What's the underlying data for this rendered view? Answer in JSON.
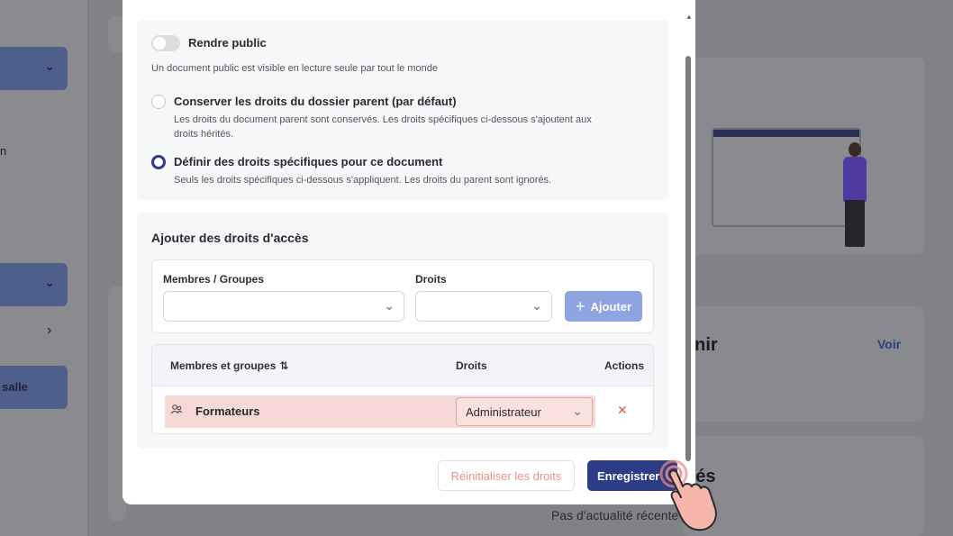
{
  "background": {
    "sidebar_item_1": "salle",
    "card_title_1": "enir",
    "card_link": "Voir",
    "card_title_2": "ités",
    "card_subtitle": "Pas d'actualité récente"
  },
  "modal": {
    "public_toggle": {
      "label": "Rendre public",
      "description": "Un document public est visible en lecture seule par tout le monde",
      "on": false
    },
    "options": [
      {
        "label": "Conserver les droits du dossier parent (par défaut)",
        "description_line1": "Les droits du document parent sont conservés. Les droits spécifiques ci-dessous s'ajoutent aux",
        "description_line2": "droits hérités.",
        "selected": false
      },
      {
        "label": "Définir des droits spécifiques pour ce document",
        "description_line1": "Seuls les droits spécifiques ci-dessous s'appliquent. Les droits du parent sont ignorés.",
        "description_line2": "",
        "selected": true
      }
    ],
    "access": {
      "title": "Ajouter des droits d'accès",
      "members_label": "Membres / Groupes",
      "rights_label": "Droits",
      "add_label": "Ajouter"
    },
    "table": {
      "col_members": "Membres et groupes",
      "col_rights": "Droits",
      "col_actions": "Actions",
      "rows": [
        {
          "name": "Formateurs",
          "right": "Administrateur"
        }
      ]
    },
    "reset_label": "Réinitialiser les droits",
    "save_label": "Enregistrer"
  },
  "colors": {
    "primary": "#2d3d85",
    "add_button": "#8ea4e0",
    "danger": "#e05a4f",
    "row_highlight": "#f6d9d6"
  },
  "icons": [
    "chevron-down-icon",
    "plus-icon",
    "sort-icon",
    "group-icon",
    "close-icon",
    "hand-pointer-icon"
  ]
}
